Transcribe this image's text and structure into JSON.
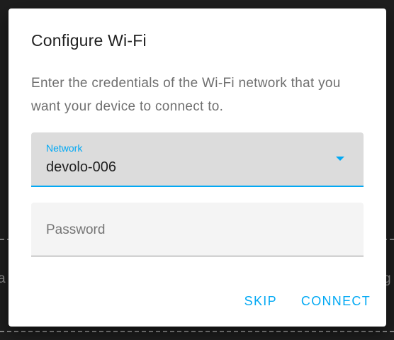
{
  "background": {
    "left_text": "a",
    "right_text": "g"
  },
  "dialog": {
    "title": "Configure Wi-Fi",
    "description": "Enter the credentials of the Wi-Fi network that you want your device to connect to.",
    "network": {
      "label": "Network",
      "value": "devolo-006"
    },
    "password": {
      "placeholder": "Password",
      "value": ""
    },
    "actions": {
      "skip_label": "SKIP",
      "connect_label": "CONNECT"
    }
  },
  "colors": {
    "accent": "#03a9f4",
    "select_background": "#dcdcdc",
    "input_background": "#f4f4f4"
  },
  "icons": {
    "dropdown": "chevron-down-icon"
  }
}
